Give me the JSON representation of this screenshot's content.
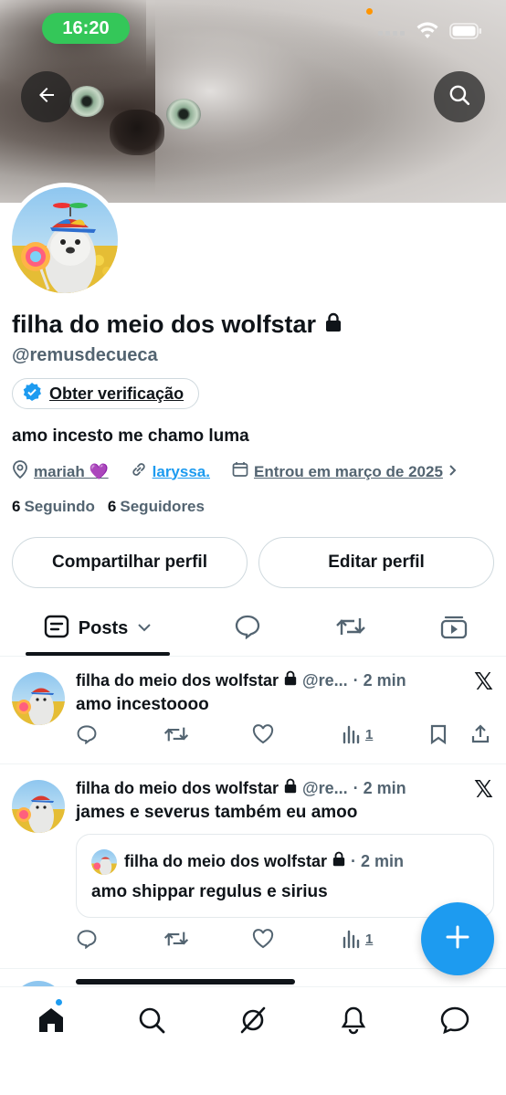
{
  "status_bar": {
    "time": "16:20"
  },
  "profile": {
    "name": "filha do meio dos wolfstar",
    "handle": "@remusdecueca",
    "verify_label": "Obter verificação",
    "bio": "amo incesto me chamo luma",
    "location": "mariah 💜",
    "website": "laryssa.",
    "joined": "Entrou em março de 2025",
    "following_count": "6",
    "following_label": "Seguindo",
    "followers_count": "6",
    "followers_label": "Seguidores",
    "share_label": "Compartilhar perfil",
    "edit_label": "Editar perfil"
  },
  "tabs": {
    "posts_label": "Posts"
  },
  "posts": [
    {
      "name": "filha do meio dos wolfstar",
      "handle": "@re...",
      "time": "· 2 min",
      "text": "amo incestoooo",
      "views": "1"
    },
    {
      "name": "filha do meio dos wolfstar",
      "handle": "@re...",
      "time": "· 2 min",
      "text": "james e severus também eu amoo",
      "views": "1",
      "quote": {
        "name": "filha do meio dos wolfstar",
        "time": "· 2 min",
        "text": "amo shippar regulus e sirius"
      }
    }
  ],
  "icons": {
    "back": "arrow-left-icon",
    "search": "search-icon",
    "lock": "lock-icon",
    "verified": "verified-badge-icon",
    "x_logo": "x-logo-icon"
  },
  "colors": {
    "accent": "#1d9bf0",
    "status_green": "#34c759",
    "secondary_text": "#536471"
  }
}
